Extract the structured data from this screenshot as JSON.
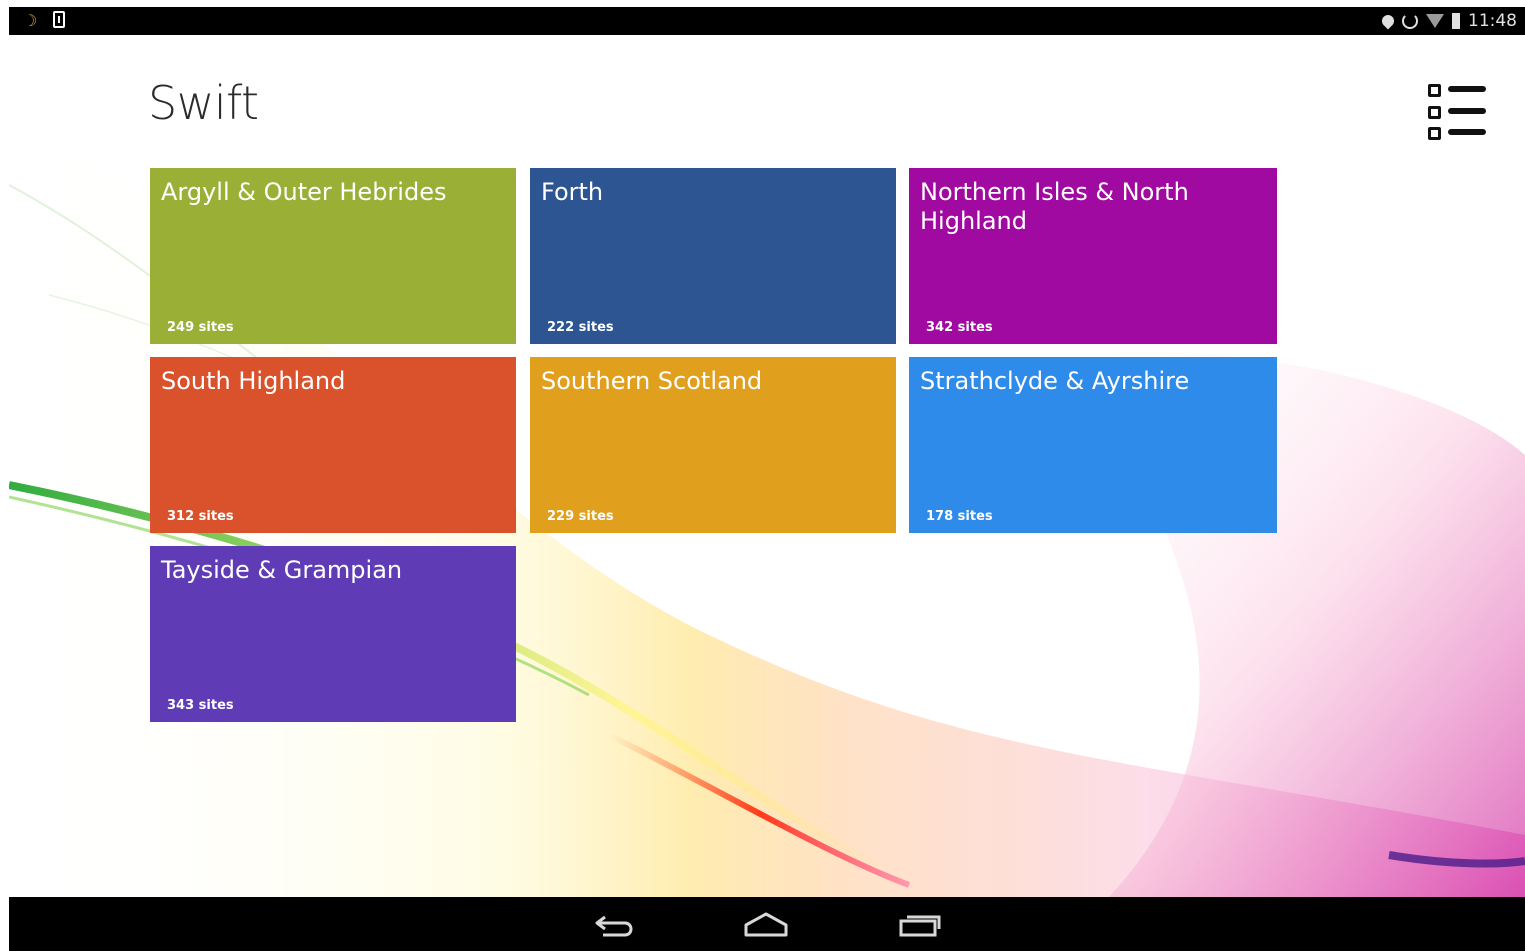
{
  "status_bar": {
    "time": "11:48",
    "icons": [
      "moon-icon",
      "download-icon",
      "location-icon",
      "sync-icon",
      "wifi-icon",
      "battery-icon"
    ]
  },
  "app": {
    "title": "Swift",
    "menu_icon": "list-view-icon"
  },
  "tiles": [
    {
      "name": "Argyll & Outer Hebrides",
      "count": "249 sites",
      "color": "#9aaf36"
    },
    {
      "name": "Forth",
      "count": "222 sites",
      "color": "#2c5592"
    },
    {
      "name": "Northern Isles & North Highland",
      "count": "342 sites",
      "color": "#a00aa0"
    },
    {
      "name": "South Highland",
      "count": "312 sites",
      "color": "#d9522c"
    },
    {
      "name": "Southern Scotland",
      "count": "229 sites",
      "color": "#e19f1e"
    },
    {
      "name": "Strathclyde & Ayrshire",
      "count": "178 sites",
      "color": "#2e8bea"
    },
    {
      "name": "Tayside & Grampian",
      "count": "343 sites",
      "color": "#5f3cb5"
    }
  ],
  "nav_bar": {
    "buttons": [
      "back-icon",
      "home-icon",
      "recent-apps-icon"
    ]
  }
}
